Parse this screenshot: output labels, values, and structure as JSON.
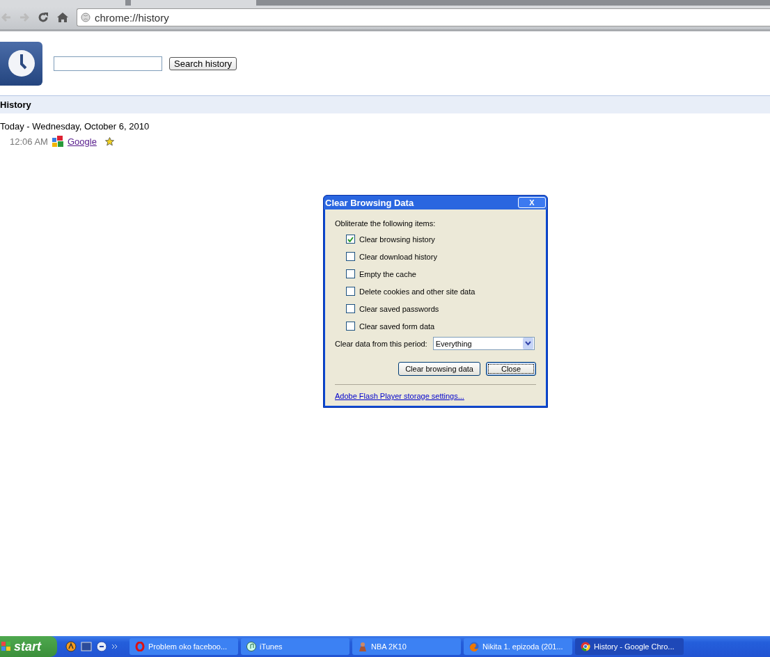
{
  "toolbar": {
    "address": "chrome://history"
  },
  "search": {
    "button": "Search history"
  },
  "section": {
    "title": "History"
  },
  "day": {
    "heading": "Today - Wednesday, October 6, 2010",
    "entries": [
      {
        "time": "12:06 AM",
        "title": "Google",
        "starred": true
      }
    ]
  },
  "dialog": {
    "title": "Clear Browsing Data",
    "close": "X",
    "intro": "Obliterate the following items:",
    "options": [
      {
        "label": "Clear browsing history",
        "checked": true
      },
      {
        "label": "Clear download history",
        "checked": false
      },
      {
        "label": "Empty the cache",
        "checked": false
      },
      {
        "label": "Delete cookies and other site data",
        "checked": false
      },
      {
        "label": "Clear saved passwords",
        "checked": false
      },
      {
        "label": "Clear saved form data",
        "checked": false
      }
    ],
    "period_label": "Clear data from this period:",
    "period": "Everything",
    "buttons": [
      {
        "label": "Clear browsing data",
        "focused": false
      },
      {
        "label": "Close",
        "focused": true
      }
    ],
    "link": "Adobe Flash Player storage settings..."
  },
  "taskbar": {
    "start": "start",
    "tasks": [
      {
        "label": "Problem oko faceboo...",
        "selected": false
      },
      {
        "label": "iTunes",
        "selected": false
      },
      {
        "label": "NBA 2K10",
        "selected": false
      },
      {
        "label": "Nikita 1. epizoda (201...",
        "selected": false
      },
      {
        "label": "History - Google Chro...",
        "selected": true
      }
    ]
  }
}
